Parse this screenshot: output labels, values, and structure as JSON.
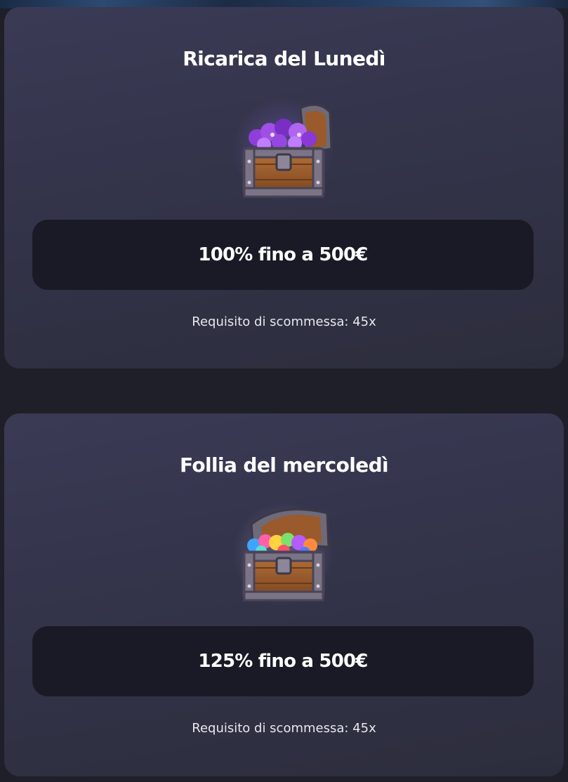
{
  "offers": [
    {
      "title": "Ricarica del Lunedì",
      "icon": "treasure-chest-purple-gems-icon",
      "amount": "100% fino a 500€",
      "wagering": "Requisito di scommessa: 45x"
    },
    {
      "title": "Follia del mercoledì",
      "icon": "treasure-chest-rainbow-gems-icon",
      "amount": "125% fino a 500€",
      "wagering": "Requisito di scommessa: 45x"
    }
  ],
  "colors": {
    "page_background": "#1e1f28",
    "card_background": "#35364c",
    "amount_box_background": "#1a1a26",
    "text_primary": "#ffffff",
    "text_secondary": "#e8e8ee"
  }
}
